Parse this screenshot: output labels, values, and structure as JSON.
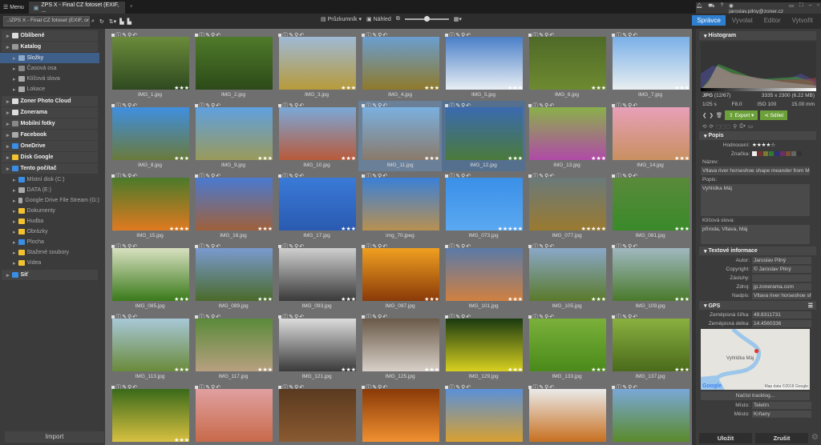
{
  "titlebar": {
    "menu": "Menu",
    "tab": "ZPS X - Final CZ fotoset (EXIF, ...",
    "new_tab": "+",
    "user": "jaroslav.pilny@zoner.cz"
  },
  "toolbar": {
    "path": "..\\ZPS X - Final CZ fotoset (EXIF, ordi",
    "explorer": "Průzkumník",
    "preview": "Náhled",
    "modes": [
      "Správce",
      "Vyvolat",
      "Editor",
      "Vytvořit"
    ]
  },
  "sidebar": {
    "items": [
      {
        "label": "Oblíbené",
        "level": "top",
        "color": "#ddd"
      },
      {
        "label": "Katalog",
        "level": "top",
        "color": "#999"
      },
      {
        "label": "Složky",
        "level": "sub",
        "color": "#8fa9c8",
        "selected": true
      },
      {
        "label": "Časová osa",
        "level": "sub",
        "color": "#888"
      },
      {
        "label": "Klíčová slova",
        "level": "sub",
        "color": "#aaa"
      },
      {
        "label": "Lokace",
        "level": "sub",
        "color": "#aaa"
      },
      {
        "label": "Zoner Photo Cloud",
        "level": "top",
        "color": "#ddd"
      },
      {
        "label": "Zonerama",
        "level": "top",
        "color": "#ddd"
      },
      {
        "label": "Mobilní fotky",
        "level": "top",
        "color": "#888"
      },
      {
        "label": "Facebook",
        "level": "top",
        "color": "#aaa"
      },
      {
        "label": "OneDrive",
        "level": "top",
        "color": "#3a8ee6"
      },
      {
        "label": "Disk Google",
        "level": "top",
        "color": "#f2c230"
      },
      {
        "label": "Tento počítač",
        "level": "top",
        "color": "#3a8ee6"
      },
      {
        "label": "Místní disk (C:)",
        "level": "sub",
        "color": "#3a8ee6"
      },
      {
        "label": "DATA (E:)",
        "level": "sub",
        "color": "#aaa"
      },
      {
        "label": "Google Drive File Stream (G:)",
        "level": "sub",
        "color": "#aaa"
      },
      {
        "label": "Dokumenty",
        "level": "sub",
        "color": "#f2c230"
      },
      {
        "label": "Hudba",
        "level": "sub",
        "color": "#f2c230"
      },
      {
        "label": "Obrázky",
        "level": "sub",
        "color": "#f2c230"
      },
      {
        "label": "Plocha",
        "level": "sub",
        "color": "#3a8ee6"
      },
      {
        "label": "Stažené soubory",
        "level": "sub",
        "color": "#f2c230"
      },
      {
        "label": "Videa",
        "level": "sub",
        "color": "#f2c230"
      },
      {
        "label": "Síť",
        "level": "top",
        "color": "#3a8ee6"
      }
    ],
    "import": "Import"
  },
  "thumbnails": [
    {
      "name": "IMG_1.jpg",
      "stars": 3,
      "c": [
        "#6a8c3a",
        "#2f4a20"
      ]
    },
    {
      "name": "IMG_2.jpg",
      "stars": 0,
      "c": [
        "#4f7a2a",
        "#2c4a18"
      ]
    },
    {
      "name": "IMG_3.jpg",
      "stars": 3,
      "c": [
        "#9fbad6",
        "#b79a3a"
      ]
    },
    {
      "name": "IMG_4.jpg",
      "stars": 3,
      "c": [
        "#6a9ed0",
        "#8f7a2a"
      ]
    },
    {
      "name": "IMG_5.jpg",
      "stars": 3,
      "c": [
        "#4a7fc8",
        "#e8eef4"
      ]
    },
    {
      "name": "IMG_6.jpg",
      "stars": 3,
      "c": [
        "#4f6a28",
        "#6d8a30"
      ]
    },
    {
      "name": "IMG_7.jpg",
      "stars": 3,
      "c": [
        "#7ab0e8",
        "#e8eef0"
      ]
    },
    {
      "name": "IMG_8.jpg",
      "stars": 3,
      "c": [
        "#3f8fe0",
        "#6a7a3a"
      ]
    },
    {
      "name": "IMG_9.jpg",
      "stars": 3,
      "c": [
        "#5fa0e0",
        "#9a9a5a"
      ]
    },
    {
      "name": "IMG_10.jpg",
      "stars": 3,
      "c": [
        "#7aa8d8",
        "#b85a3a"
      ]
    },
    {
      "name": "IMG_11.jpg",
      "stars": 3,
      "c": [
        "#7ab0e0",
        "#8a7a6a"
      ]
    },
    {
      "name": "IMG_12.jpg",
      "stars": 3,
      "c": [
        "#3a6ab0",
        "#4a7a3a"
      ]
    },
    {
      "name": "IMG_13.jpg",
      "stars": 3,
      "c": [
        "#8ab04a",
        "#b04aa8"
      ]
    },
    {
      "name": "IMG_14.jpg",
      "stars": 3,
      "c": [
        "#e8a0b8",
        "#c89060"
      ]
    },
    {
      "name": "IMG_15.jpg",
      "stars": 4,
      "c": [
        "#4a7a2a",
        "#e07a20"
      ]
    },
    {
      "name": "IMG_16.jpg",
      "stars": 3,
      "c": [
        "#4a7ad0",
        "#a0603a"
      ]
    },
    {
      "name": "IMG_17.jpg",
      "stars": 3,
      "c": [
        "#3a7ad8",
        "#2a5ab0"
      ]
    },
    {
      "name": "img_70.jpeg",
      "stars": 0,
      "c": [
        "#3a80d8",
        "#b89050"
      ]
    },
    {
      "name": "IMG_073.jpg",
      "stars": 5,
      "c": [
        "#3a90e8",
        "#5aa8f0"
      ]
    },
    {
      "name": "IMG_077.jpg",
      "stars": 5,
      "c": [
        "#6a7a7a",
        "#9a7a30"
      ]
    },
    {
      "name": "IMG_081.jpg",
      "stars": 3,
      "c": [
        "#5a8a3a",
        "#3a8a2a"
      ]
    },
    {
      "name": "IMG_085.jpg",
      "stars": 3,
      "c": [
        "#d8e0c0",
        "#3a7a1a"
      ]
    },
    {
      "name": "IMG_089.jpg",
      "stars": 3,
      "c": [
        "#7a9ad0",
        "#4a6a2a"
      ]
    },
    {
      "name": "IMG_093.jpg",
      "stars": 3,
      "c": [
        "#cfcfcf",
        "#3a3a3a"
      ]
    },
    {
      "name": "IMG_097.jpg",
      "stars": 3,
      "c": [
        "#f0a020",
        "#8a3a08"
      ]
    },
    {
      "name": "IMG_101.jpg",
      "stars": 3,
      "c": [
        "#5a7aa8",
        "#d08040"
      ]
    },
    {
      "name": "IMG_105.jpg",
      "stars": 3,
      "c": [
        "#8aa8c8",
        "#5a7a2a"
      ]
    },
    {
      "name": "IMG_109.jpg",
      "stars": 3,
      "c": [
        "#a0b8c0",
        "#4a7a2a"
      ]
    },
    {
      "name": "IMG_113.jpg",
      "stars": 3,
      "c": [
        "#a8c8d8",
        "#6a8a3a"
      ]
    },
    {
      "name": "IMG_117.jpg",
      "stars": 3,
      "c": [
        "#5a8a3a",
        "#b8a080"
      ]
    },
    {
      "name": "IMG_121.jpg",
      "stars": 3,
      "c": [
        "#dcdcdc",
        "#3a3a3a"
      ]
    },
    {
      "name": "IMG_125.jpg",
      "stars": 3,
      "c": [
        "#6a5a48",
        "#d8d0c8"
      ]
    },
    {
      "name": "IMG_129.jpg",
      "stars": 3,
      "c": [
        "#1a3a10",
        "#d8d020"
      ]
    },
    {
      "name": "IMG_133.jpg",
      "stars": 3,
      "c": [
        "#7ab03a",
        "#4a8a1a"
      ]
    },
    {
      "name": "IMG_137.jpg",
      "stars": 3,
      "c": [
        "#8ab040",
        "#4a6a1a"
      ]
    },
    {
      "name": "",
      "stars": 3,
      "c": [
        "#3a6a1a",
        "#d8c040"
      ]
    },
    {
      "name": "",
      "stars": 0,
      "c": [
        "#e0a0a0",
        "#c86a4a"
      ]
    },
    {
      "name": "",
      "stars": 0,
      "c": [
        "#5a3a20",
        "#8a5a30"
      ]
    },
    {
      "name": "",
      "stars": 0,
      "c": [
        "#8a3a08",
        "#f09030"
      ]
    },
    {
      "name": "",
      "stars": 0,
      "c": [
        "#5a90d8",
        "#d8a030"
      ]
    },
    {
      "name": "",
      "stars": 0,
      "c": [
        "#eaeaea",
        "#c87020"
      ]
    },
    {
      "name": "",
      "stars": 0,
      "c": [
        "#7aa8d8",
        "#5a8a2a"
      ]
    }
  ],
  "right": {
    "histogram": "Histogram",
    "format": "JPG",
    "index": "(12/67)",
    "dimensions": "3335 x 2300 (6.22 MB)",
    "shutter": "1/25 s",
    "aperture": "F8.0",
    "iso": "ISO 100",
    "focal": "15.00 mm",
    "export": "Export",
    "share": "Sdílet",
    "popis_section": "Popis",
    "rating_label": "Hodnocení:",
    "rating": 4,
    "label_label": "Značka:",
    "title_label": "Název:",
    "title_value": "Vltava river horseshoe shape meander from Máj vi",
    "desc_label": "Popis:",
    "desc_value": "Vyhlídka Máj",
    "keywords_label": "Klíčová slova:",
    "keywords_value": "příroda, Vltava, Máj",
    "text_section": "Textové informace",
    "author_label": "Autor:",
    "author": "Jaroslav Pilný",
    "copyright_label": "Copyright:",
    "copyright": "© Jaroslav Pilný",
    "credits_label": "Zásluhy:",
    "credits": "",
    "source_label": "Zdroj:",
    "source": "jp.zonerama.com",
    "headline_label": "Nadpis:",
    "headline": "Vltava river horseshoe shape",
    "gps_section": "GPS",
    "lat_label": "Zeměpisná šířka:",
    "lat": "49.8311731",
    "lon_label": "Zeměpisná délka:",
    "lon": "14.4560336",
    "map_place": "Vyhlídka Máj",
    "map_credit": "Map data ©2018 Google",
    "google": "Google",
    "tracklog": "Načíst tracklog...",
    "place_label": "Místo:",
    "place": "Teletín",
    "city_label": "Město:",
    "city": "Krňany",
    "save": "Uložit",
    "cancel": "Zrušit"
  },
  "colors": {
    "accent": "#2f7fd0",
    "green": "#6ca03a",
    "selected": "#55708f"
  }
}
